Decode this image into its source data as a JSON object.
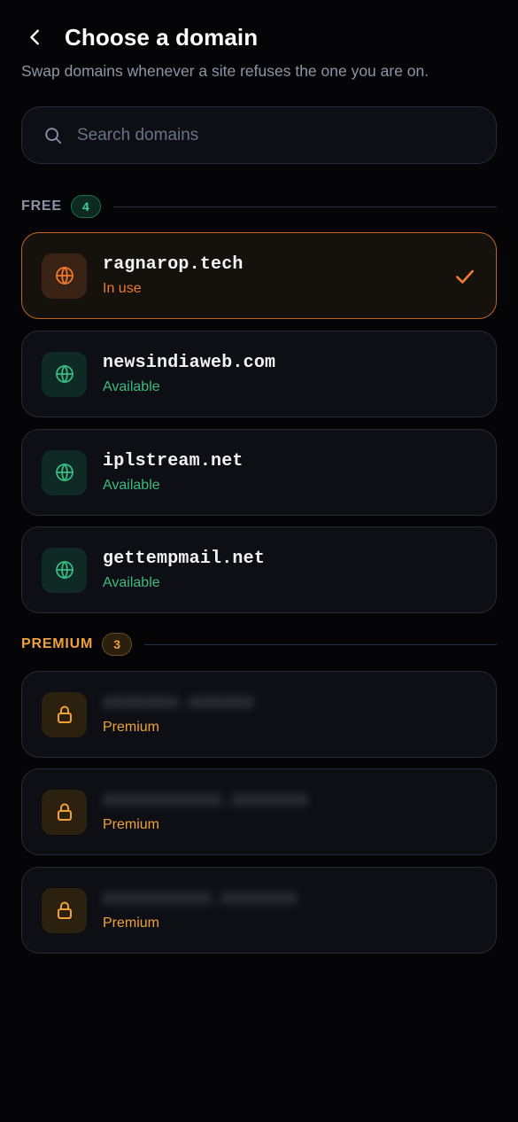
{
  "header": {
    "title": "Choose a domain",
    "subtitle": "Swap domains whenever a site refuses the one you are on."
  },
  "search": {
    "placeholder": "Search domains",
    "value": ""
  },
  "sections": {
    "free": {
      "label": "FREE",
      "count": "4",
      "items": [
        {
          "name": "ragnarop.tech",
          "status": "In use",
          "state": "active",
          "icon": "globe-icon"
        },
        {
          "name": "newsindiaweb.com",
          "status": "Available",
          "state": "available",
          "icon": "globe-icon"
        },
        {
          "name": "iplstream.net",
          "status": "Available",
          "state": "available",
          "icon": "globe-icon"
        },
        {
          "name": "gettempmail.net",
          "status": "Available",
          "state": "available",
          "icon": "globe-icon"
        }
      ]
    },
    "premium": {
      "label": "PREMIUM",
      "count": "3",
      "items": [
        {
          "name": "",
          "status": "Premium",
          "state": "locked",
          "icon": "lock-icon"
        },
        {
          "name": "",
          "status": "Premium",
          "state": "locked",
          "icon": "lock-icon"
        },
        {
          "name": "",
          "status": "Premium",
          "state": "locked",
          "icon": "lock-icon"
        }
      ]
    }
  },
  "colors": {
    "background": "#050507",
    "accent_orange": "#ee7a33",
    "available_green": "#3bbb84",
    "premium_amber": "#f0a13a"
  }
}
